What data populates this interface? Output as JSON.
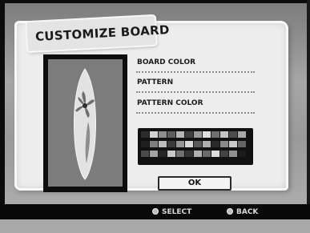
{
  "screen": {
    "title": "CUSTOMIZE BOARD",
    "options": [
      {
        "label": "BOARD COLOR"
      },
      {
        "label": "PATTERN"
      },
      {
        "label": "PATTERN COLOR"
      }
    ],
    "ok_label": "OK",
    "footer": {
      "select_label": "SELECT",
      "back_label": "BACK"
    }
  },
  "palette": {
    "rows": [
      [
        "#2c2c2c",
        "#d2d2d2",
        "#8c8c8c",
        "#5e5e5e",
        "#b7b7b7",
        "#3f3f3f",
        "#9a9a9a",
        "#e0e0e0",
        "#6f6f6f",
        "#c4c4c4",
        "#4e4e4e",
        "#a8a8a8"
      ],
      [
        "#1e1e1e",
        "#7e7e7e",
        "#bcbcbc",
        "#3a3a3a",
        "#969696",
        "#d8d8d8",
        "#585858",
        "#aeaeae",
        "#2a2a2a",
        "#8a8a8a",
        "#cbcbcb",
        "#656565"
      ],
      [
        "#4a4a4a",
        "#a2a2a2",
        "#262626",
        "#c9c9c9",
        "#717171",
        "#353535",
        "#b2b2b2",
        "#6a6a6a",
        "#dcdcdc",
        "#434343",
        "#919191",
        "#1b1b1b"
      ]
    ]
  },
  "colors": {
    "board_fill": "#e2e2e2",
    "pattern_color": "#7a7a7a"
  }
}
